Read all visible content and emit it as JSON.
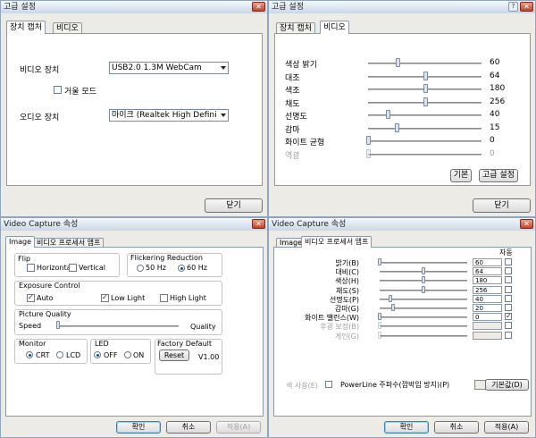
{
  "w1": {
    "title": "고급 설정",
    "tabs": [
      "장치 캡처",
      "비디오"
    ],
    "video_device_label": "비디오 장치",
    "video_device_value": "USB2.0 1.3M WebCam",
    "mirror_label": "거울 모드",
    "audio_device_label": "오디오 장치",
    "audio_device_value": "마이크 (Realtek High Defini",
    "close_label": "닫기"
  },
  "w2": {
    "title": "고급 설정",
    "tabs": [
      "장치 캡처",
      "비디오"
    ],
    "sliders": [
      {
        "label": "색상 밝기",
        "value": "60",
        "level": 0.26
      },
      {
        "label": "대조",
        "value": "64",
        "level": 0.5
      },
      {
        "label": "색조",
        "value": "180",
        "level": 0.5
      },
      {
        "label": "채도",
        "value": "256",
        "level": 0.5
      },
      {
        "label": "선명도",
        "value": "40",
        "level": 0.17
      },
      {
        "label": "감마",
        "value": "15",
        "level": 0.25
      },
      {
        "label": "화이트 균형",
        "value": "0",
        "level": 0.0
      },
      {
        "label": "역광",
        "value": "0",
        "level": 0.0,
        "disabled": true
      }
    ],
    "default_label": "기본",
    "advanced_label": "고급 설정",
    "close_label": "닫기"
  },
  "w3": {
    "title": "Video Capture 속성",
    "tabs": [
      "Image",
      "비디오 프로세서 앰프"
    ],
    "flip_label": "Flip",
    "horizontal": "Horizontal",
    "vertical": "Vertical",
    "flicker_label": "Flickering Reduction",
    "hz50": "50 Hz",
    "hz60": "60 Hz",
    "exposure_label": "Exposure Control",
    "auto": "Auto",
    "low_light": "Low Light",
    "high_light": "High Light",
    "quality_label": "Picture Quality",
    "speed": "Speed",
    "quality": "Quality",
    "monitor_label": "Monitor",
    "crt": "CRT",
    "lcd": "LCD",
    "led_label": "LED",
    "off": "OFF",
    "on": "ON",
    "factory_label": "Factory Default",
    "reset": "Reset",
    "version": "V1.00",
    "ok": "확인",
    "cancel": "취소",
    "apply": "적용(A)"
  },
  "w4": {
    "title": "Video Capture 속성",
    "tabs": [
      "Image",
      "비디오 프로세서 앰프"
    ],
    "auto_header": "자동",
    "rows": [
      {
        "label": "밝기(B)",
        "value": "60",
        "level": 0.0
      },
      {
        "label": "대비(C)",
        "value": "64",
        "level": 0.5
      },
      {
        "label": "색상(H)",
        "value": "180",
        "level": 0.5
      },
      {
        "label": "채도(S)",
        "value": "256",
        "level": 0.5
      },
      {
        "label": "선명도(P)",
        "value": "40",
        "level": 0.12
      },
      {
        "label": "감마(G)",
        "value": "20",
        "level": 0.15
      },
      {
        "label": "화이트 밸런스(W)",
        "value": "0",
        "level": 0.0,
        "auto": true
      },
      {
        "label": "후광 보정(B)",
        "value": "",
        "level": 0.0,
        "disabled": true
      },
      {
        "label": "게인(G)",
        "value": "",
        "level": 0.0,
        "disabled": true
      }
    ],
    "color_label": "색 사용(E)",
    "powerline_label": "PowerLine 주파수(깜박임 방지)(P)",
    "default_label": "기본값(D)",
    "ok": "확인",
    "cancel": "취소",
    "apply": "적용(A)"
  }
}
